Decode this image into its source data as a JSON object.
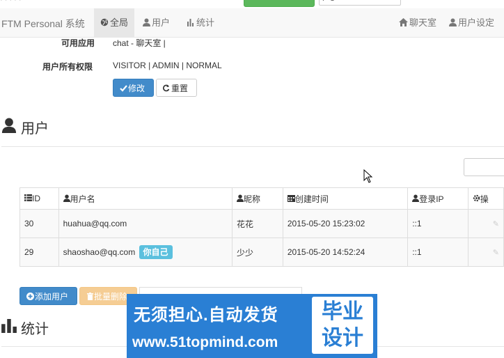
{
  "topbar": {
    "left_text": "· · · · ·",
    "green_button": "",
    "white_button": "P C · · · ·"
  },
  "navbar": {
    "brand": "FTM Personal 系统",
    "items": [
      {
        "label": "全局",
        "icon": "globe-icon",
        "active": true
      },
      {
        "label": "用户",
        "icon": "user-icon",
        "active": false
      },
      {
        "label": "统计",
        "icon": "bar-chart-icon",
        "active": false
      }
    ],
    "right_items": [
      {
        "label": "聊天室",
        "icon": "home-icon"
      },
      {
        "label": "用户设定",
        "icon": "user-icon"
      }
    ]
  },
  "settings": {
    "apps_label": "可用应用",
    "apps_value": "chat - 聊天室 |",
    "perms_label": "用户所有权限",
    "perms_value": "VISITOR | ADMIN | NORMAL",
    "edit_button": "修改",
    "reset_button": "重置"
  },
  "users_section": {
    "title": "用户",
    "columns": [
      {
        "label": "ID",
        "icon": "list-icon"
      },
      {
        "label": "用户名",
        "icon": "user-icon"
      },
      {
        "label": "昵称",
        "icon": "user-icon"
      },
      {
        "label": "创建时间",
        "icon": "calendar-icon"
      },
      {
        "label": "登录IP",
        "icon": "user-icon"
      },
      {
        "label": "操",
        "icon": "gear-icon"
      }
    ],
    "rows": [
      {
        "id": "30",
        "username": "huahua@qq.com",
        "badge": "",
        "nickname": "花花",
        "created": "2015-05-20 15:23:02",
        "ip": "::1"
      },
      {
        "id": "29",
        "username": "shaoshao@qq.com",
        "badge": "你自己",
        "nickname": "少少",
        "created": "2015-05-20 14:52:24",
        "ip": "::1"
      }
    ],
    "add_button": "添加用户",
    "batch_delete_button": "批量删除"
  },
  "stats_section": {
    "title": "统计"
  },
  "watermark": {
    "line1": "无须担心.自动发货",
    "line2": "www.51topmind.com",
    "box_line1": "毕业",
    "box_line2": "设计"
  },
  "colors": {
    "primary": "#428bca",
    "info": "#5bc0de",
    "warning": "#f0ad4e",
    "success": "#5cb85c",
    "watermark_bg": "#2a7fd4"
  }
}
